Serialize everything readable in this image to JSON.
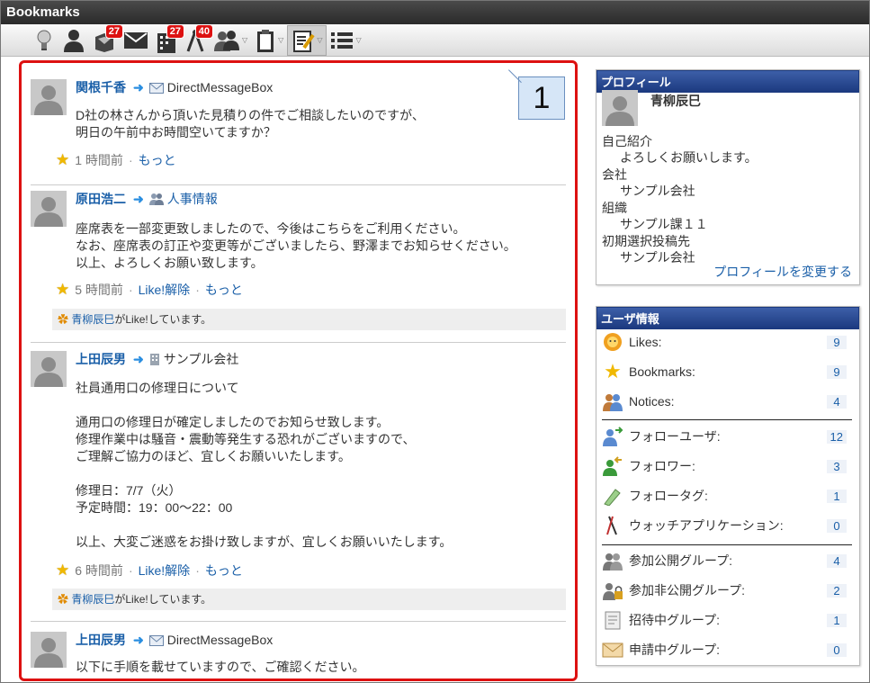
{
  "window": {
    "title": "Bookmarks"
  },
  "toolbar": {
    "items": [
      {
        "name": "idea",
        "badge": ""
      },
      {
        "name": "profile",
        "badge": ""
      },
      {
        "name": "inbox",
        "badge": "27"
      },
      {
        "name": "mail",
        "badge": ""
      },
      {
        "name": "company",
        "badge": "27"
      },
      {
        "name": "watch",
        "badge": "40"
      },
      {
        "name": "users",
        "badge": ""
      },
      {
        "name": "clipboard",
        "badge": ""
      },
      {
        "name": "bookmarks",
        "badge": ""
      },
      {
        "name": "list",
        "badge": ""
      }
    ]
  },
  "callout": {
    "number": "1"
  },
  "posts": [
    {
      "author": "関根千香",
      "target": "DirectMessageBox",
      "target_icon": "mail-icon",
      "body": "D社の林さんから頂いた見積りの件でご相談したいのですが、\n明日の午前中お時間空いてますか？",
      "time": "1 時間前",
      "like_action": "",
      "more": "もっと",
      "liked_by": "",
      "liked_suffix": ""
    },
    {
      "author": "原田浩二",
      "target": "人事情報",
      "target_icon": "group-icon",
      "body": "座席表を一部変更致しましたので、今後はこちらをご利用ください。\nなお、座席表の訂正や変更等がございましたら、野澤までお知らせください。\n以上、よろしくお願い致します。",
      "time": "5 時間前",
      "like_action": "Like!解除",
      "more": "もっと",
      "liked_by": "青柳辰巳",
      "liked_suffix": "がLike!しています。"
    },
    {
      "author": "上田辰男",
      "target": "サンプル会社",
      "target_icon": "building-icon",
      "body": "社員通用口の修理日について\n\n通用口の修理日が確定しましたのでお知らせ致します。\n修理作業中は騒音・震動等発生する恐れがございますので、\nご理解ご協力のほど、宜しくお願いいたします。\n\n修理日：7/7（火）\n予定時間：19：00〜22：00\n\n以上、大変ご迷惑をお掛け致しますが、宜しくお願いいたします。",
      "time": "6 時間前",
      "like_action": "Like!解除",
      "more": "もっと",
      "liked_by": "青柳辰巳",
      "liked_suffix": "がLike!しています。"
    },
    {
      "author": "上田辰男",
      "target": "DirectMessageBox",
      "target_icon": "mail-icon",
      "body": "以下に手順を載せていますので、ご確認ください。",
      "time": "",
      "like_action": "",
      "more": "",
      "liked_by": "",
      "liked_suffix": ""
    }
  ],
  "profile": {
    "title": "プロフィール",
    "name": "青柳辰巳",
    "fields": [
      {
        "label": "自己紹介",
        "value": "よろしくお願いします。"
      },
      {
        "label": "会社",
        "value": "サンプル会社"
      },
      {
        "label": "組織",
        "value": "サンプル課１１"
      },
      {
        "label": "初期選択投稿先",
        "value": "サンプル会社"
      }
    ],
    "change_link": "プロフィールを変更する"
  },
  "userinfo": {
    "title": "ユーザ情報",
    "rows": [
      {
        "icon": "likes-icon",
        "label": "Likes:",
        "count": "9"
      },
      {
        "icon": "bookmarks-icon",
        "label": "Bookmarks:",
        "count": "9"
      },
      {
        "icon": "notices-icon",
        "label": "Notices:",
        "count": "4"
      },
      {
        "icon": "follow-user-icon",
        "label": "フォローユーザ:",
        "count": "12"
      },
      {
        "icon": "follower-icon",
        "label": "フォロワー:",
        "count": "3"
      },
      {
        "icon": "follow-tag-icon",
        "label": "フォロータグ:",
        "count": "1"
      },
      {
        "icon": "watch-app-icon",
        "label": "ウォッチアプリケーション:",
        "count": "0"
      },
      {
        "icon": "public-group-icon",
        "label": "参加公開グループ:",
        "count": "4"
      },
      {
        "icon": "private-group-icon",
        "label": "参加非公開グループ:",
        "count": "2"
      },
      {
        "icon": "invited-group-icon",
        "label": "招待中グループ:",
        "count": "1"
      },
      {
        "icon": "applying-group-icon",
        "label": "申請中グループ:",
        "count": "0"
      }
    ]
  }
}
